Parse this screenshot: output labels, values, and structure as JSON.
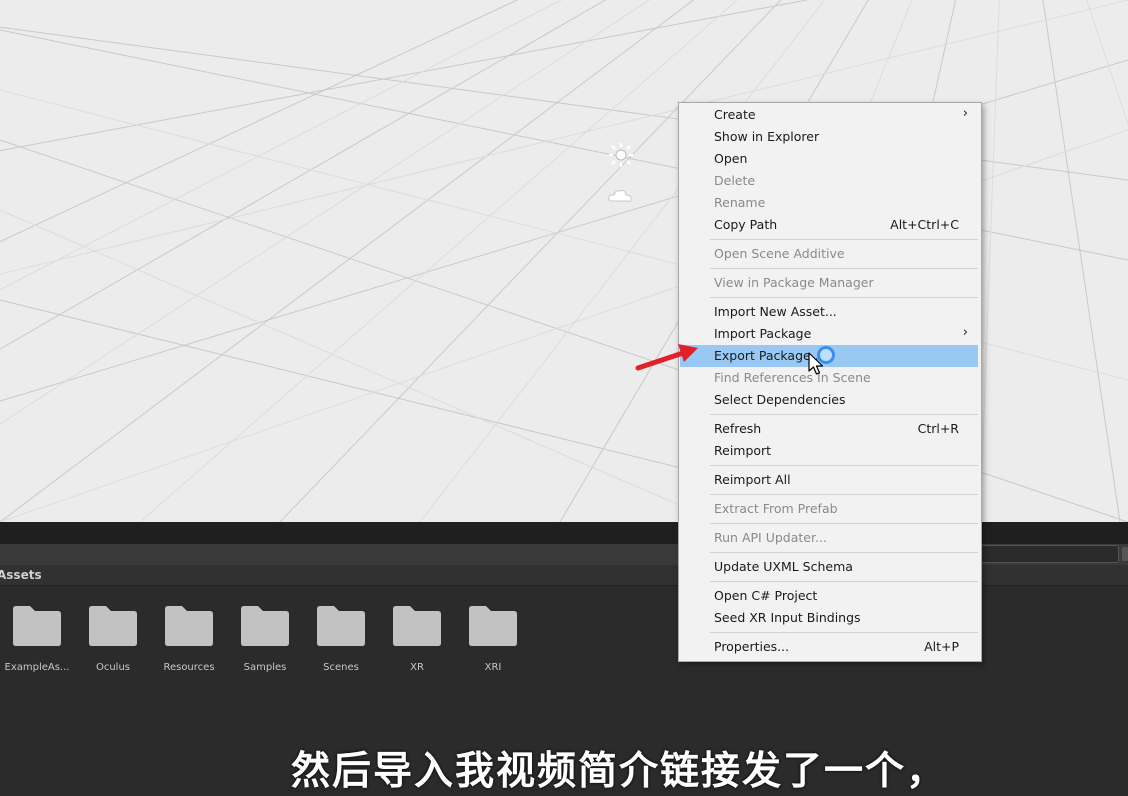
{
  "project": {
    "breadcrumb": "Assets",
    "folders": [
      {
        "label": "ExampleAs..."
      },
      {
        "label": "Oculus"
      },
      {
        "label": "Resources"
      },
      {
        "label": "Samples"
      },
      {
        "label": "Scenes"
      },
      {
        "label": "XR"
      },
      {
        "label": "XRI"
      }
    ]
  },
  "scene": {
    "icons": [
      "sun-icon",
      "cloud-icon"
    ]
  },
  "context_menu": {
    "items": [
      {
        "label": "Create",
        "shortcut": "",
        "submenu": true,
        "disabled": false
      },
      {
        "label": "Show in Explorer",
        "shortcut": "",
        "submenu": false,
        "disabled": false
      },
      {
        "label": "Open",
        "shortcut": "",
        "submenu": false,
        "disabled": false
      },
      {
        "label": "Delete",
        "shortcut": "",
        "submenu": false,
        "disabled": true
      },
      {
        "label": "Rename",
        "shortcut": "",
        "submenu": false,
        "disabled": true
      },
      {
        "label": "Copy Path",
        "shortcut": "Alt+Ctrl+C",
        "submenu": false,
        "disabled": false
      },
      {
        "label": "Open Scene Additive",
        "shortcut": "",
        "submenu": false,
        "disabled": true
      },
      {
        "label": "View in Package Manager",
        "shortcut": "",
        "submenu": false,
        "disabled": true
      },
      {
        "label": "Import New Asset...",
        "shortcut": "",
        "submenu": false,
        "disabled": false
      },
      {
        "label": "Import Package",
        "shortcut": "",
        "submenu": true,
        "disabled": false
      },
      {
        "label": "Export Package...",
        "shortcut": "",
        "submenu": false,
        "disabled": false,
        "highlighted": true
      },
      {
        "label": "Find References In Scene",
        "shortcut": "",
        "submenu": false,
        "disabled": true
      },
      {
        "label": "Select Dependencies",
        "shortcut": "",
        "submenu": false,
        "disabled": false
      },
      {
        "label": "Refresh",
        "shortcut": "Ctrl+R",
        "submenu": false,
        "disabled": false
      },
      {
        "label": "Reimport",
        "shortcut": "",
        "submenu": false,
        "disabled": false
      },
      {
        "label": "Reimport All",
        "shortcut": "",
        "submenu": false,
        "disabled": false
      },
      {
        "label": "Extract From Prefab",
        "shortcut": "",
        "submenu": false,
        "disabled": true
      },
      {
        "label": "Run API Updater...",
        "shortcut": "",
        "submenu": false,
        "disabled": true
      },
      {
        "label": "Update UXML Schema",
        "shortcut": "",
        "submenu": false,
        "disabled": false
      },
      {
        "label": "Open C# Project",
        "shortcut": "",
        "submenu": false,
        "disabled": false
      },
      {
        "label": "Seed XR Input Bindings",
        "shortcut": "",
        "submenu": false,
        "disabled": false
      },
      {
        "label": "Properties...",
        "shortcut": "Alt+P",
        "submenu": false,
        "disabled": false
      }
    ],
    "submenu_glyph": "›"
  },
  "subtitle": "然后导入我视频简介链接发了一个，",
  "colors": {
    "highlight": "#99c9f2",
    "annotation_arrow": "#e0202a",
    "scene_bg": "#ececec",
    "panel_bg": "#2b2b2b"
  }
}
